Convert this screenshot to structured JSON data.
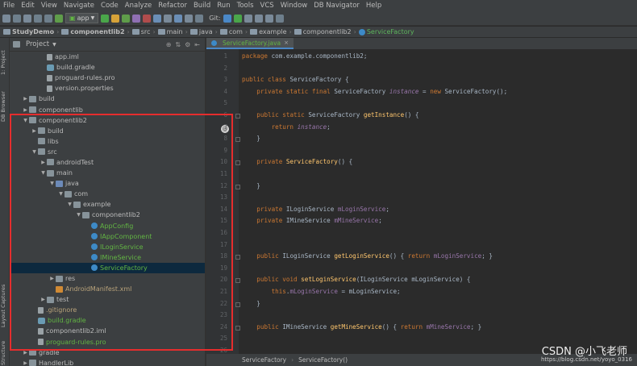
{
  "menu": [
    "File",
    "Edit",
    "View",
    "Navigate",
    "Code",
    "Analyze",
    "Refactor",
    "Build",
    "Run",
    "Tools",
    "VCS",
    "Window",
    "DB Navigator",
    "Help"
  ],
  "toolbar": {
    "run_config": "app",
    "git_label": "Git:"
  },
  "breadcrumbs": [
    "StudyDemo",
    "componentlib2",
    "src",
    "main",
    "java",
    "com",
    "example",
    "componentlib2",
    "ServiceFactory"
  ],
  "left_tool_tabs": [
    "1: Project",
    "DB Browser",
    "Layout Captures",
    "Structure"
  ],
  "project_panel": {
    "title": "Project"
  },
  "tree": [
    {
      "label": "app.iml",
      "indent": 3,
      "arrow": "",
      "icon": "file",
      "cls": ""
    },
    {
      "label": "build.gradle",
      "indent": 3,
      "arrow": "",
      "icon": "gradle",
      "cls": ""
    },
    {
      "label": "proguard-rules.pro",
      "indent": 3,
      "arrow": "",
      "icon": "file",
      "cls": ""
    },
    {
      "label": "version.properties",
      "indent": 3,
      "arrow": "",
      "icon": "file",
      "cls": ""
    },
    {
      "label": "build",
      "indent": 1,
      "arrow": "▶",
      "icon": "folder",
      "cls": ""
    },
    {
      "label": "componentlib",
      "indent": 1,
      "arrow": "▶",
      "icon": "folder",
      "cls": ""
    },
    {
      "label": "componentlib2",
      "indent": 1,
      "arrow": "▼",
      "icon": "folder",
      "cls": ""
    },
    {
      "label": "build",
      "indent": 2,
      "arrow": "▶",
      "icon": "folder",
      "cls": ""
    },
    {
      "label": "libs",
      "indent": 2,
      "arrow": "",
      "icon": "folder",
      "cls": ""
    },
    {
      "label": "src",
      "indent": 2,
      "arrow": "▼",
      "icon": "folder",
      "cls": ""
    },
    {
      "label": "androidTest",
      "indent": 3,
      "arrow": "▶",
      "icon": "folder",
      "cls": ""
    },
    {
      "label": "main",
      "indent": 3,
      "arrow": "▼",
      "icon": "folder",
      "cls": ""
    },
    {
      "label": "java",
      "indent": 4,
      "arrow": "▼",
      "icon": "srcfolder",
      "cls": ""
    },
    {
      "label": "com",
      "indent": 5,
      "arrow": "▼",
      "icon": "folder",
      "cls": ""
    },
    {
      "label": "example",
      "indent": 6,
      "arrow": "▼",
      "icon": "folder",
      "cls": ""
    },
    {
      "label": "componentlib2",
      "indent": 7,
      "arrow": "▼",
      "icon": "folder",
      "cls": ""
    },
    {
      "label": "AppConfig",
      "indent": 8,
      "arrow": "",
      "icon": "cls",
      "cls": "green"
    },
    {
      "label": "IAppComponent",
      "indent": 8,
      "arrow": "",
      "icon": "cls",
      "cls": "green"
    },
    {
      "label": "ILoginService",
      "indent": 8,
      "arrow": "",
      "icon": "cls",
      "cls": "green"
    },
    {
      "label": "IMineService",
      "indent": 8,
      "arrow": "",
      "icon": "cls",
      "cls": "green"
    },
    {
      "label": "ServiceFactory",
      "indent": 8,
      "arrow": "",
      "icon": "cls",
      "cls": "green",
      "selected": true
    },
    {
      "label": "res",
      "indent": 4,
      "arrow": "▶",
      "icon": "folder",
      "cls": ""
    },
    {
      "label": "AndroidManifest.xml",
      "indent": 4,
      "arrow": "",
      "icon": "xml",
      "cls": "amber"
    },
    {
      "label": "test",
      "indent": 3,
      "arrow": "▶",
      "icon": "folder",
      "cls": ""
    },
    {
      "label": ".gitignore",
      "indent": 2,
      "arrow": "",
      "icon": "file",
      "cls": "amber"
    },
    {
      "label": "build.gradle",
      "indent": 2,
      "arrow": "",
      "icon": "gradle",
      "cls": "green"
    },
    {
      "label": "componentlib2.iml",
      "indent": 2,
      "arrow": "",
      "icon": "file",
      "cls": ""
    },
    {
      "label": "proguard-rules.pro",
      "indent": 2,
      "arrow": "",
      "icon": "file",
      "cls": "green"
    },
    {
      "label": "gradle",
      "indent": 1,
      "arrow": "▶",
      "icon": "folder",
      "cls": ""
    },
    {
      "label": "HandlerLib",
      "indent": 1,
      "arrow": "▶",
      "icon": "folder",
      "cls": ""
    }
  ],
  "editor": {
    "tab_label": "ServiceFactory.java",
    "line_numbers": [
      "1",
      "2",
      "3",
      "4",
      "5",
      "6",
      "7",
      "8",
      "9",
      "10",
      "11",
      "12",
      "13",
      "14",
      "15",
      "16",
      "17",
      "18",
      "19",
      "20",
      "21",
      "22",
      "23",
      "24",
      "25",
      "26",
      "27"
    ],
    "code_lines": [
      [
        [
          "kw",
          "package "
        ],
        [
          "",
          "com.example.componentlib2;"
        ]
      ],
      [],
      [
        [
          "kw",
          "public class "
        ],
        [
          "",
          "ServiceFactory {"
        ]
      ],
      [
        [
          "",
          "    "
        ],
        [
          "kw",
          "private static final "
        ],
        [
          "",
          "ServiceFactory "
        ],
        [
          "fi",
          "instance"
        ],
        [
          "",
          " = "
        ],
        [
          "kw",
          "new "
        ],
        [
          "",
          "ServiceFactory();"
        ]
      ],
      [],
      [
        [
          "",
          "    "
        ],
        [
          "kw",
          "public static "
        ],
        [
          "",
          "ServiceFactory "
        ],
        [
          "fn",
          "getInstance"
        ],
        [
          "",
          "() {"
        ]
      ],
      [
        [
          "",
          "        "
        ],
        [
          "kw",
          "return "
        ],
        [
          "fi",
          "instance"
        ],
        [
          "",
          ";"
        ]
      ],
      [
        [
          "",
          "    }"
        ]
      ],
      [],
      [
        [
          "",
          "    "
        ],
        [
          "kw",
          "private "
        ],
        [
          "fn",
          "ServiceFactory"
        ],
        [
          "",
          "() {"
        ]
      ],
      [],
      [
        [
          "",
          "    }"
        ]
      ],
      [],
      [
        [
          "",
          "    "
        ],
        [
          "kw",
          "private "
        ],
        [
          "",
          "ILoginService "
        ],
        [
          "fld",
          "mLoginService"
        ],
        [
          "",
          ";"
        ]
      ],
      [
        [
          "",
          "    "
        ],
        [
          "kw",
          "private "
        ],
        [
          "",
          "IMineService "
        ],
        [
          "fld",
          "mMineService"
        ],
        [
          "",
          ";"
        ]
      ],
      [],
      [],
      [
        [
          "",
          "    "
        ],
        [
          "kw",
          "public "
        ],
        [
          "",
          "ILoginService "
        ],
        [
          "fn",
          "getLoginService"
        ],
        [
          "",
          "() { "
        ],
        [
          "kw",
          "return "
        ],
        [
          "fld",
          "mLoginService"
        ],
        [
          "",
          "; }"
        ]
      ],
      [],
      [
        [
          "",
          "    "
        ],
        [
          "kw",
          "public void "
        ],
        [
          "fn",
          "setLoginService"
        ],
        [
          "",
          "(ILoginService mLoginService) {"
        ]
      ],
      [
        [
          "",
          "        "
        ],
        [
          "kw",
          "this"
        ],
        [
          "",
          "."
        ],
        [
          "fld",
          "mLoginService"
        ],
        [
          "",
          " = mLoginService;"
        ]
      ],
      [
        [
          "",
          "    }"
        ]
      ],
      [],
      [
        [
          "",
          "    "
        ],
        [
          "kw",
          "public "
        ],
        [
          "",
          "IMineService "
        ],
        [
          "fn",
          "getMineService"
        ],
        [
          "",
          "() { "
        ],
        [
          "kw",
          "return "
        ],
        [
          "fld",
          "mMineService"
        ],
        [
          "",
          "; }"
        ]
      ],
      [],
      [],
      []
    ]
  },
  "status_breadcrumbs": [
    "ServiceFactory",
    "ServiceFactory()"
  ],
  "watermark": "CSDN @小飞老师",
  "watermark_url": "https://blog.csdn.net/yoyo_0316"
}
